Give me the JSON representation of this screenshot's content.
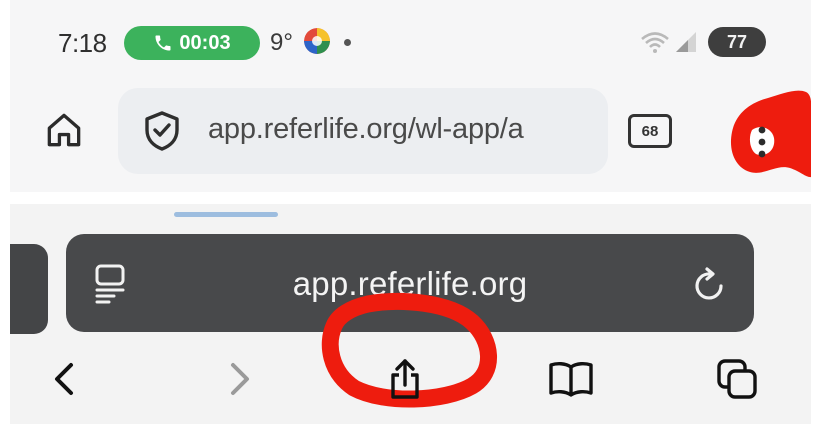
{
  "android": {
    "status_bar": {
      "time": "7:18",
      "call_timer": "00:03",
      "temperature": "9°",
      "battery_level": "77"
    },
    "chrome": {
      "url": "app.referlife.org/wl-app/a",
      "tab_count": "68",
      "icons": {
        "home": "home-icon",
        "security": "shield-check-icon",
        "tabs": "tab-switcher-icon",
        "menu": "more-vert-icon"
      }
    }
  },
  "safari": {
    "address_bar": {
      "url": "app.referlife.org"
    },
    "toolbar": {
      "icons": [
        "back-icon",
        "forward-icon",
        "share-icon",
        "bookmarks-icon",
        "tabs-icon"
      ]
    }
  },
  "annotations": {
    "highlight_color": "#ee1c0e",
    "highlighted": [
      "android-menu-button",
      "safari-share-button"
    ]
  },
  "colors": {
    "call_pill": "#3cb25c",
    "safari_bar": "#48494b",
    "battery": "#3e3e3e"
  }
}
